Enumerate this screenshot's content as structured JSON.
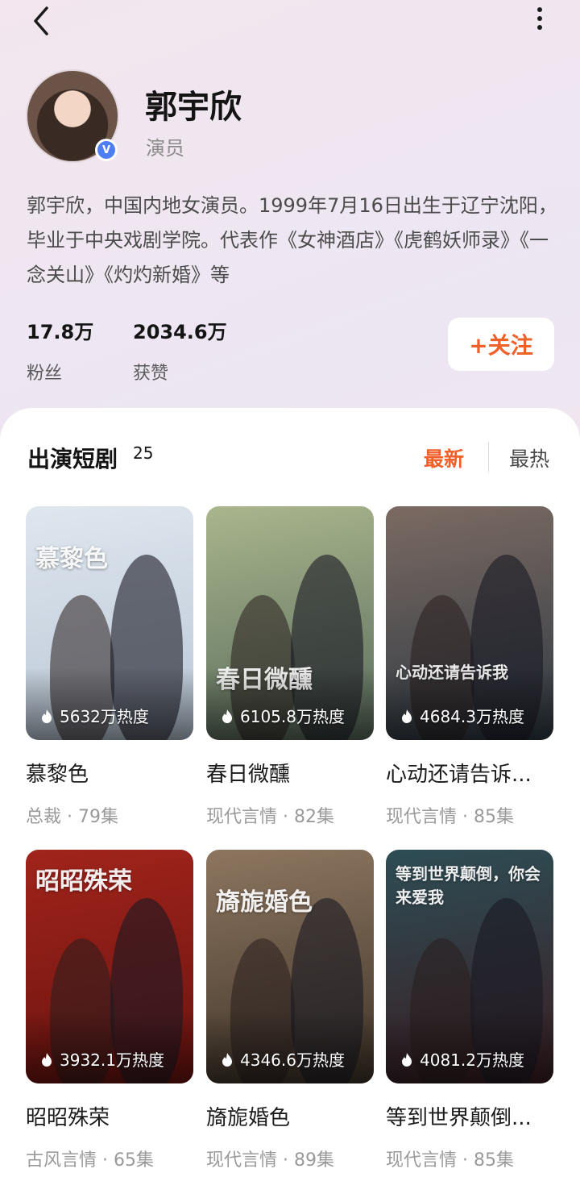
{
  "header": {
    "name": "郭宇欣",
    "role": "演员",
    "bio": "郭宇欣，中国内地女演员。1999年7月16日出生于辽宁沈阳，毕业于中央戏剧学院。代表作《女神酒店》《虎鹤妖师录》《一念关山》《灼灼新婚》等",
    "verified_badge": "V"
  },
  "stats": {
    "fans_value": "17.8万",
    "fans_label": "粉丝",
    "likes_value": "2034.6万",
    "likes_label": "获赞"
  },
  "follow_label": "+关注",
  "section": {
    "title": "出演短剧",
    "count": "25",
    "sort_new": "最新",
    "sort_hot": "最热"
  },
  "dramas": [
    {
      "title": "慕黎色",
      "meta": "总裁 · 79集",
      "heat": "5632万热度",
      "poster_text": "慕黎色",
      "colors": [
        "#dfe6ee",
        "#b9c7d6"
      ]
    },
    {
      "title": "春日微醺",
      "meta": "现代言情 · 82集",
      "heat": "6105.8万热度",
      "poster_text": "春日微醺",
      "colors": [
        "#a9b58c",
        "#596b5c"
      ]
    },
    {
      "title": "心动还请告诉...",
      "meta": "现代言情 · 85集",
      "heat": "4684.3万热度",
      "poster_text": "心动还请告诉我",
      "colors": [
        "#7b6a62",
        "#2f3a44"
      ]
    },
    {
      "title": "昭昭殊荣",
      "meta": "古风言情 · 65集",
      "heat": "3932.1万热度",
      "poster_text": "昭昭殊荣",
      "colors": [
        "#a0241b",
        "#6b130f"
      ]
    },
    {
      "title": "旖旎婚色",
      "meta": "现代言情 · 89集",
      "heat": "4346.6万热度",
      "poster_text": "旖旎婚色",
      "colors": [
        "#8d7660",
        "#3f3429"
      ]
    },
    {
      "title": "等到世界颠倒...",
      "meta": "现代言情 · 85集",
      "heat": "4081.2万热度",
      "poster_text": "等到世界颠倒，你会来爱我",
      "colors": [
        "#2e4d55",
        "#3a1d22"
      ]
    }
  ]
}
